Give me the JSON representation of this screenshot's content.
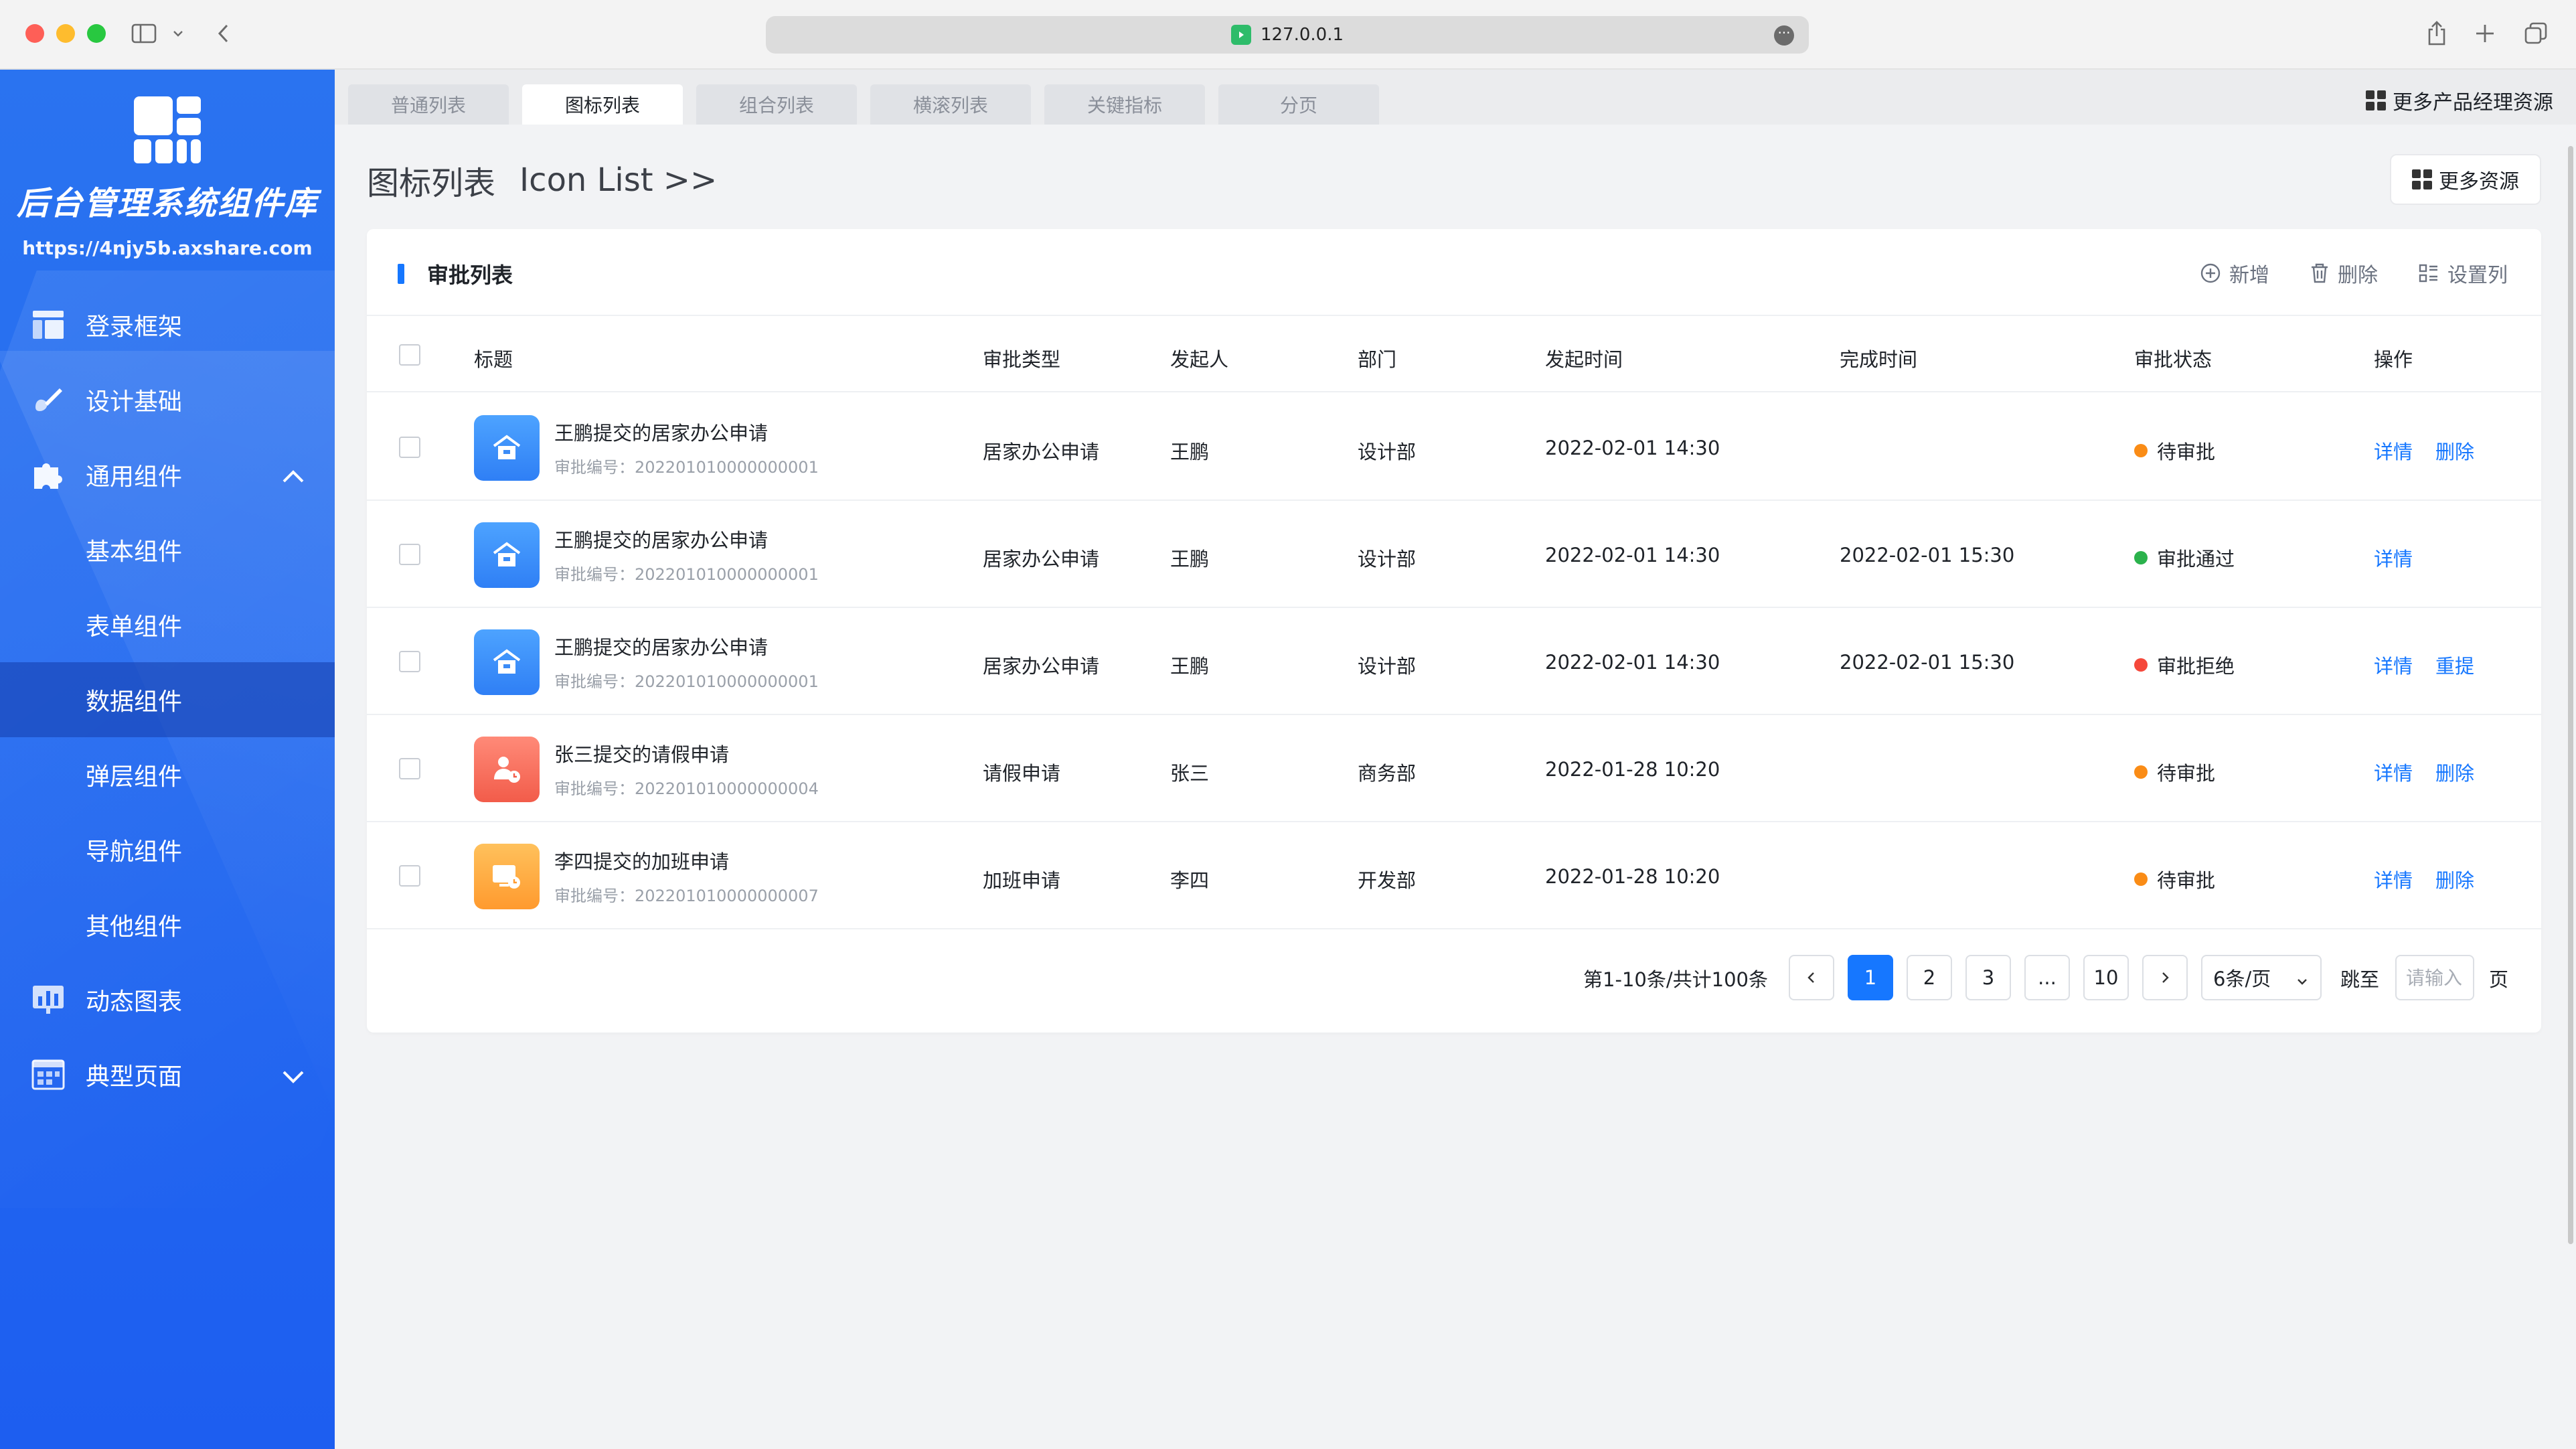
{
  "browser": {
    "url": "127.0.0.1"
  },
  "sidebar": {
    "brand_title": "后台管理系统组件库",
    "brand_url": "https://4njy5b.axshare.com",
    "items": [
      {
        "label": "登录框架",
        "icon": "layout-icon"
      },
      {
        "label": "设计基础",
        "icon": "palette-icon"
      },
      {
        "label": "通用组件",
        "icon": "puzzle-icon",
        "expanded": true
      },
      {
        "label": "基本组件"
      },
      {
        "label": "表单组件"
      },
      {
        "label": "数据组件",
        "active": true
      },
      {
        "label": "弹层组件"
      },
      {
        "label": "导航组件"
      },
      {
        "label": "其他组件"
      },
      {
        "label": "动态图表",
        "icon": "chart-icon"
      },
      {
        "label": "典型页面",
        "icon": "page-icon",
        "expanded": false
      }
    ]
  },
  "tabs": [
    "普通列表",
    "图标列表",
    "组合列表",
    "横滚列表",
    "关键指标",
    "分页"
  ],
  "active_tab": 1,
  "top_resources": "更多产品经理资源",
  "page": {
    "title": "图标列表",
    "title_en": "Icon List >>",
    "more_resources": "更多资源"
  },
  "card": {
    "title": "审批列表",
    "actions": {
      "add": "新增",
      "delete": "删除",
      "columns": "设置列"
    },
    "columns": [
      "标题",
      "审批类型",
      "发起人",
      "部门",
      "发起时间",
      "完成时间",
      "审批状态",
      "操作"
    ],
    "rows": [
      {
        "title": "王鹏提交的居家办公申请",
        "sub": "审批编号：202201010000000001",
        "type": "居家办公申请",
        "initiator": "王鹏",
        "dept": "设计部",
        "start": "2022-02-01 14:30",
        "end": "",
        "status": "待审批",
        "status_color": "#fa8c16",
        "icon": "home-icon",
        "avatar_color": "blue",
        "actions": [
          "详情",
          "删除"
        ]
      },
      {
        "title": "王鹏提交的居家办公申请",
        "sub": "审批编号：202201010000000001",
        "type": "居家办公申请",
        "initiator": "王鹏",
        "dept": "设计部",
        "start": "2022-02-01 14:30",
        "end": "2022-02-01 15:30",
        "status": "审批通过",
        "status_color": "#2bb24c",
        "icon": "home-icon",
        "avatar_color": "blue",
        "actions": [
          "详情"
        ]
      },
      {
        "title": "王鹏提交的居家办公申请",
        "sub": "审批编号：202201010000000001",
        "type": "居家办公申请",
        "initiator": "王鹏",
        "dept": "设计部",
        "start": "2022-02-01 14:30",
        "end": "2022-02-01 15:30",
        "status": "审批拒绝",
        "status_color": "#f5483b",
        "icon": "home-icon",
        "avatar_color": "blue",
        "actions": [
          "详情",
          "重提"
        ]
      },
      {
        "title": "张三提交的请假申请",
        "sub": "审批编号：202201010000000004",
        "type": "请假申请",
        "initiator": "张三",
        "dept": "商务部",
        "start": "2022-01-28 10:20",
        "end": "",
        "status": "待审批",
        "status_color": "#fa8c16",
        "icon": "person-clock-icon",
        "avatar_color": "red",
        "actions": [
          "详情",
          "删除"
        ]
      },
      {
        "title": "李四提交的加班申请",
        "sub": "审批编号：202201010000000007",
        "type": "加班申请",
        "initiator": "李四",
        "dept": "开发部",
        "start": "2022-01-28 10:20",
        "end": "",
        "status": "待审批",
        "status_color": "#fa8c16",
        "icon": "screen-clock-icon",
        "avatar_color": "orange",
        "actions": [
          "详情",
          "删除"
        ]
      }
    ]
  },
  "pagination": {
    "total": "第1-10条/共计100条",
    "pages": [
      "1",
      "2",
      "3",
      "...",
      "10"
    ],
    "current": "1",
    "page_size": "6条/页",
    "jump_label": "跳至",
    "jump_placeholder": "请输入",
    "unit": "页"
  },
  "colors": {
    "primary": "#1677ff",
    "sidebar": "#2568f0"
  }
}
